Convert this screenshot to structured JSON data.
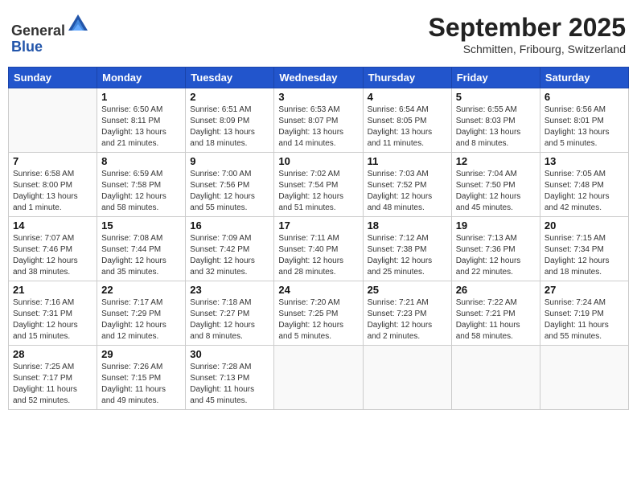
{
  "header": {
    "logo_line1": "General",
    "logo_line2": "Blue",
    "month": "September 2025",
    "location": "Schmitten, Fribourg, Switzerland"
  },
  "weekdays": [
    "Sunday",
    "Monday",
    "Tuesday",
    "Wednesday",
    "Thursday",
    "Friday",
    "Saturday"
  ],
  "weeks": [
    [
      {
        "day": "",
        "info": ""
      },
      {
        "day": "1",
        "info": "Sunrise: 6:50 AM\nSunset: 8:11 PM\nDaylight: 13 hours\nand 21 minutes."
      },
      {
        "day": "2",
        "info": "Sunrise: 6:51 AM\nSunset: 8:09 PM\nDaylight: 13 hours\nand 18 minutes."
      },
      {
        "day": "3",
        "info": "Sunrise: 6:53 AM\nSunset: 8:07 PM\nDaylight: 13 hours\nand 14 minutes."
      },
      {
        "day": "4",
        "info": "Sunrise: 6:54 AM\nSunset: 8:05 PM\nDaylight: 13 hours\nand 11 minutes."
      },
      {
        "day": "5",
        "info": "Sunrise: 6:55 AM\nSunset: 8:03 PM\nDaylight: 13 hours\nand 8 minutes."
      },
      {
        "day": "6",
        "info": "Sunrise: 6:56 AM\nSunset: 8:01 PM\nDaylight: 13 hours\nand 5 minutes."
      }
    ],
    [
      {
        "day": "7",
        "info": "Sunrise: 6:58 AM\nSunset: 8:00 PM\nDaylight: 13 hours\nand 1 minute."
      },
      {
        "day": "8",
        "info": "Sunrise: 6:59 AM\nSunset: 7:58 PM\nDaylight: 12 hours\nand 58 minutes."
      },
      {
        "day": "9",
        "info": "Sunrise: 7:00 AM\nSunset: 7:56 PM\nDaylight: 12 hours\nand 55 minutes."
      },
      {
        "day": "10",
        "info": "Sunrise: 7:02 AM\nSunset: 7:54 PM\nDaylight: 12 hours\nand 51 minutes."
      },
      {
        "day": "11",
        "info": "Sunrise: 7:03 AM\nSunset: 7:52 PM\nDaylight: 12 hours\nand 48 minutes."
      },
      {
        "day": "12",
        "info": "Sunrise: 7:04 AM\nSunset: 7:50 PM\nDaylight: 12 hours\nand 45 minutes."
      },
      {
        "day": "13",
        "info": "Sunrise: 7:05 AM\nSunset: 7:48 PM\nDaylight: 12 hours\nand 42 minutes."
      }
    ],
    [
      {
        "day": "14",
        "info": "Sunrise: 7:07 AM\nSunset: 7:46 PM\nDaylight: 12 hours\nand 38 minutes."
      },
      {
        "day": "15",
        "info": "Sunrise: 7:08 AM\nSunset: 7:44 PM\nDaylight: 12 hours\nand 35 minutes."
      },
      {
        "day": "16",
        "info": "Sunrise: 7:09 AM\nSunset: 7:42 PM\nDaylight: 12 hours\nand 32 minutes."
      },
      {
        "day": "17",
        "info": "Sunrise: 7:11 AM\nSunset: 7:40 PM\nDaylight: 12 hours\nand 28 minutes."
      },
      {
        "day": "18",
        "info": "Sunrise: 7:12 AM\nSunset: 7:38 PM\nDaylight: 12 hours\nand 25 minutes."
      },
      {
        "day": "19",
        "info": "Sunrise: 7:13 AM\nSunset: 7:36 PM\nDaylight: 12 hours\nand 22 minutes."
      },
      {
        "day": "20",
        "info": "Sunrise: 7:15 AM\nSunset: 7:34 PM\nDaylight: 12 hours\nand 18 minutes."
      }
    ],
    [
      {
        "day": "21",
        "info": "Sunrise: 7:16 AM\nSunset: 7:31 PM\nDaylight: 12 hours\nand 15 minutes."
      },
      {
        "day": "22",
        "info": "Sunrise: 7:17 AM\nSunset: 7:29 PM\nDaylight: 12 hours\nand 12 minutes."
      },
      {
        "day": "23",
        "info": "Sunrise: 7:18 AM\nSunset: 7:27 PM\nDaylight: 12 hours\nand 8 minutes."
      },
      {
        "day": "24",
        "info": "Sunrise: 7:20 AM\nSunset: 7:25 PM\nDaylight: 12 hours\nand 5 minutes."
      },
      {
        "day": "25",
        "info": "Sunrise: 7:21 AM\nSunset: 7:23 PM\nDaylight: 12 hours\nand 2 minutes."
      },
      {
        "day": "26",
        "info": "Sunrise: 7:22 AM\nSunset: 7:21 PM\nDaylight: 11 hours\nand 58 minutes."
      },
      {
        "day": "27",
        "info": "Sunrise: 7:24 AM\nSunset: 7:19 PM\nDaylight: 11 hours\nand 55 minutes."
      }
    ],
    [
      {
        "day": "28",
        "info": "Sunrise: 7:25 AM\nSunset: 7:17 PM\nDaylight: 11 hours\nand 52 minutes."
      },
      {
        "day": "29",
        "info": "Sunrise: 7:26 AM\nSunset: 7:15 PM\nDaylight: 11 hours\nand 49 minutes."
      },
      {
        "day": "30",
        "info": "Sunrise: 7:28 AM\nSunset: 7:13 PM\nDaylight: 11 hours\nand 45 minutes."
      },
      {
        "day": "",
        "info": ""
      },
      {
        "day": "",
        "info": ""
      },
      {
        "day": "",
        "info": ""
      },
      {
        "day": "",
        "info": ""
      }
    ]
  ]
}
